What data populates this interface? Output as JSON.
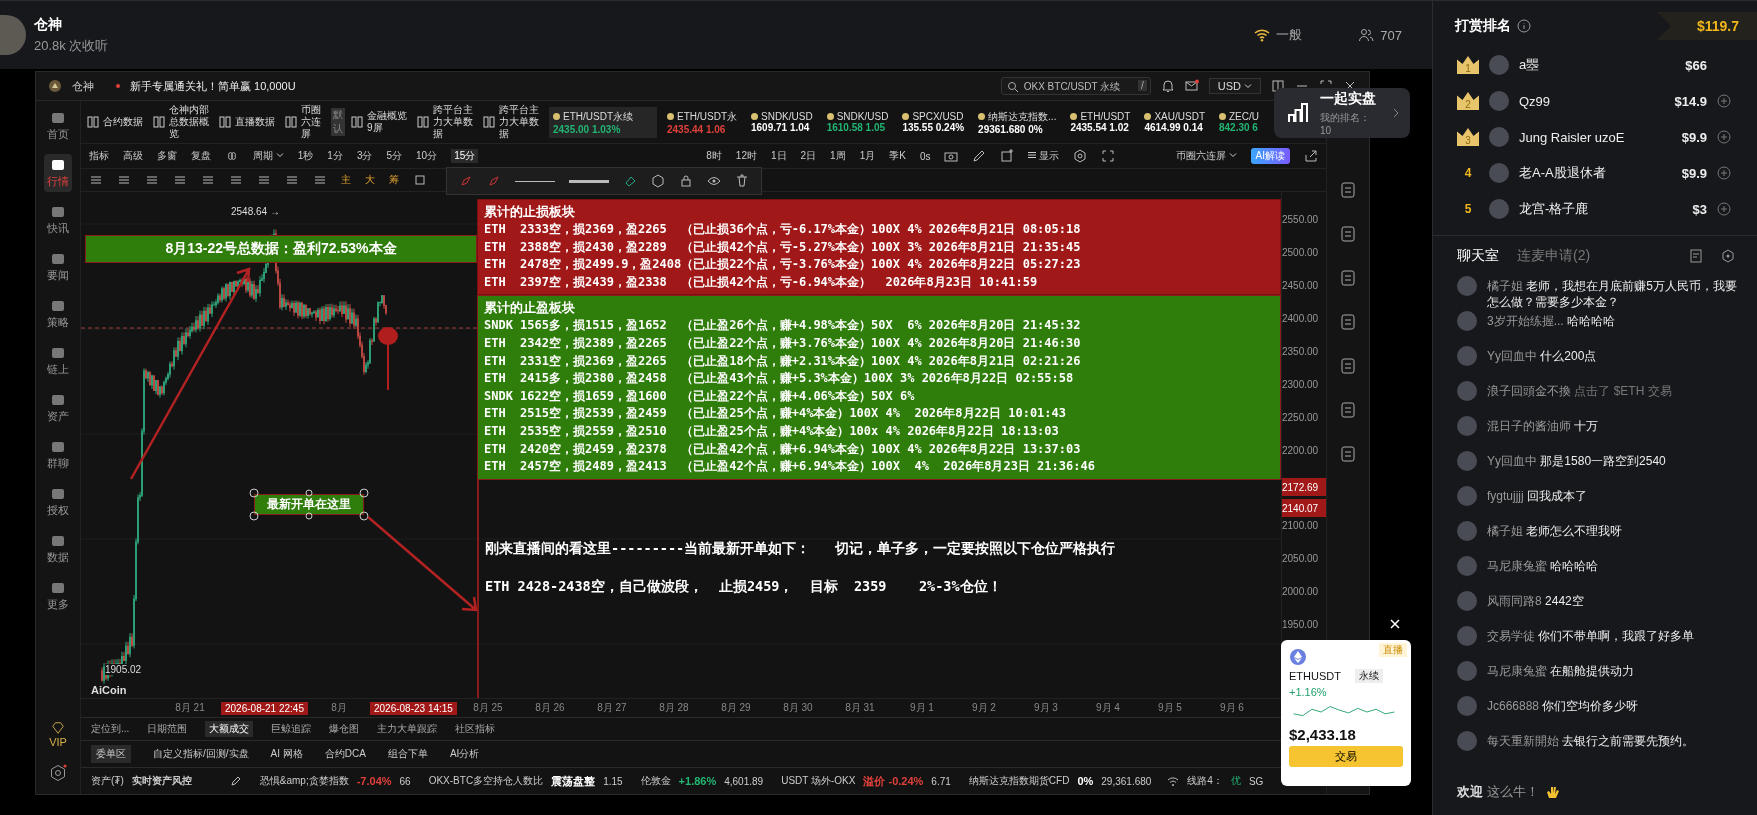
{
  "header": {
    "streamer": "仓神",
    "listeners": "20.8k 次收听",
    "signal": "一般",
    "viewers": "707"
  },
  "app": {
    "brand": "仓神",
    "promo": "新手专属通关礼！简单赢 10,000U",
    "search": {
      "placeholder": "OKX BTC/USDT 永续",
      "shortcut": "/"
    },
    "currency": "USD"
  },
  "sidebar": [
    {
      "label": "首页",
      "selected": false
    },
    {
      "label": "行情",
      "selected": true
    },
    {
      "label": "快讯",
      "selected": false
    },
    {
      "label": "要闻",
      "selected": false
    },
    {
      "label": "策略",
      "selected": false
    },
    {
      "label": "链上",
      "selected": false
    },
    {
      "label": "资产",
      "selected": false
    },
    {
      "label": "群聊",
      "selected": false
    },
    {
      "label": "授权",
      "selected": false
    },
    {
      "label": "数据",
      "selected": false
    },
    {
      "label": "更多",
      "selected": false
    }
  ],
  "vip": "VIP",
  "shortcuts": [
    {
      "label": "合约数据"
    },
    {
      "label": "仓神内部总数据概览"
    },
    {
      "label": "直播数据"
    },
    {
      "label": "币圈六连屏",
      "badge": "默认"
    },
    {
      "label": "金融概览9屏"
    },
    {
      "label": "跨平台主力大单数据"
    },
    {
      "label": "跨平台主力大单数据"
    }
  ],
  "tickers": [
    {
      "symbol": "ETH/USDT永续",
      "price": "2435.00",
      "change": "1.03%",
      "color": "#22b573",
      "selected": true
    },
    {
      "symbol": "ETH/USDT永",
      "price": "2435.44",
      "change": "1.06",
      "color": "#e0403a",
      "selected": false
    },
    {
      "symbol": "SNDK/USD",
      "price": "1609.71",
      "change": "1.04",
      "color": "#ffffff",
      "selected": false
    },
    {
      "symbol": "SNDK/USD",
      "price": "1610.58",
      "change": "1.05",
      "color": "#22b573",
      "selected": false
    },
    {
      "symbol": "SPCX/USD",
      "price": "135.55",
      "change": "0.24%",
      "color": "#ffffff",
      "selected": false
    },
    {
      "symbol": "纳斯达克指数...",
      "price": "29361.680",
      "change": "0%",
      "color": "#ffffff",
      "selected": false
    },
    {
      "symbol": "ETH/USDT",
      "price": "2435.54",
      "change": "1.02",
      "color": "#ffffff",
      "selected": false
    },
    {
      "symbol": "XAU/USDT",
      "price": "4614.99",
      "change": "0.14",
      "color": "#ffffff",
      "selected": false
    },
    {
      "symbol": "ZEC/U",
      "price": "842.30",
      "change": "6",
      "color": "#22b573",
      "selected": false
    }
  ],
  "toolbar": {
    "tools": [
      "指标",
      "高级",
      "多窗",
      "复盘"
    ],
    "period_menu": "周期",
    "periods": [
      {
        "label": "1秒",
        "selected": false
      },
      {
        "label": "1分",
        "selected": false
      },
      {
        "label": "3分",
        "selected": false
      },
      {
        "label": "5分",
        "selected": false
      },
      {
        "label": "10分",
        "selected": false
      },
      {
        "label": "15分",
        "selected": true
      },
      {
        "label": "8时",
        "selected": false
      },
      {
        "label": "12时",
        "selected": false
      },
      {
        "label": "1日",
        "selected": false
      },
      {
        "label": "2日",
        "selected": false
      },
      {
        "label": "1周",
        "selected": false
      },
      {
        "label": "1月",
        "selected": false
      },
      {
        "label": "季K",
        "selected": false
      }
    ],
    "countdown": "0s",
    "display": "显示",
    "layout": "币圈六连屏",
    "ai": "AI解读",
    "overlays": [
      "主",
      "大",
      "筹"
    ]
  },
  "chart": {
    "price_axis": [
      {
        "kind": "tick",
        "label": "2550.00"
      },
      {
        "kind": "tick",
        "label": "2500.00"
      },
      {
        "kind": "tick",
        "label": "2450.00"
      },
      {
        "kind": "tick",
        "label": "2400.00"
      },
      {
        "kind": "tick",
        "label": "2350.00"
      },
      {
        "kind": "tick",
        "label": "2300.00"
      },
      {
        "kind": "tick",
        "label": "2250.00"
      },
      {
        "kind": "tick",
        "label": "2200.00"
      },
      {
        "kind": "tag",
        "label": "2172.69"
      },
      {
        "kind": "tag",
        "label": "2140.07"
      },
      {
        "kind": "tick",
        "label": "2100.00"
      },
      {
        "kind": "tick",
        "label": "2050.00"
      },
      {
        "kind": "tick",
        "label": "2000.00"
      },
      {
        "kind": "tick",
        "label": "1950.00"
      }
    ],
    "time_axis": [
      {
        "kind": "tick",
        "label": "8月 21"
      },
      {
        "kind": "tag",
        "label": "2026-08-21 22:45"
      },
      {
        "kind": "tick",
        "label": "8月"
      },
      {
        "kind": "tag",
        "label": "2026-08-23 14:15"
      },
      {
        "kind": "tick",
        "label": "8月 25"
      },
      {
        "kind": "tick",
        "label": "8月 26"
      },
      {
        "kind": "tick",
        "label": "8月 27"
      },
      {
        "kind": "tick",
        "label": "8月 28"
      },
      {
        "kind": "tick",
        "label": "8月 29"
      },
      {
        "kind": "tick",
        "label": "8月 30"
      },
      {
        "kind": "tick",
        "label": "8月 31"
      },
      {
        "kind": "tick",
        "label": "9月 1"
      },
      {
        "kind": "tick",
        "label": "9月 2"
      },
      {
        "kind": "tick",
        "label": "9月 3"
      },
      {
        "kind": "tick",
        "label": "9月 4"
      },
      {
        "kind": "tick",
        "label": "9月 5"
      },
      {
        "kind": "tick",
        "label": "9月 6"
      }
    ],
    "high": "2548.64 →",
    "low": "1905.02",
    "logo": "AiCoin",
    "banner": "8月13-22号总数据：盈利72.53%本金",
    "marker": "最新开单在这里",
    "loss_block": {
      "title": "累计的止损板块",
      "lines": [
        "ETH  2333空，损2369，盈2265  （已止损36个点，亏-6.17%本金）100X 4% 2026年8月21日 08:05:18",
        "ETH  2388空，损2430，盈2289  （已止损42个点，亏-5.27%本金）100X 3% 2026年8月21日 21:35:45",
        "ETH  2478空，损2499.9，盈2408（已止损22个点，亏-3.76%本金）100X 4% 2026年8月22日 05:27:23",
        "ETH  2397空，损2439，盈2338  （已止损42个点，亏-6.94%本金）  2026年8月23日 10:41:59"
      ]
    },
    "profit_block": {
      "title": "累计的止盈板块",
      "lines": [
        "SNDK 1565多，损1515，盈1652  （已止盈26个点，赚+4.98%本金）50X  6% 2026年8月20日 21:45:32",
        "ETH  2342空，损2389，盈2265  （已止盈22个点，赚+3.76%本金）100X 4% 2026年8月20日 21:46:30",
        "ETH  2331空，损2369，盈2265  （已止盈18个点，赚+2.31%本金）100X 4% 2026年8月21日 02:21:26",
        "ETH  2415多，损2380，盈2458  （已止盈43个点，赚+5.3%本金）100X 3% 2026年8月22日 02:55:58",
        "SNDK 1622空，损1659，盈1600  （已止盈22个点，赚+4.06%本金）50X 6%",
        "ETH  2515空，损2539，盈2459  （已止盈25个点，赚+4%本金）100X 4%  2026年8月22日 10:01:43",
        "ETH  2535空，损2559，盈2510  （已止盈25个点，赚+4%本金）100x 4% 2026年8月22日 18:13:03",
        "ETH  2420空，损2459，盈2378  （已止盈42个点，赚+6.94%本金）100X 4% 2026年8月22日 13:37:03",
        "ETH  2457空，损2489，盈2413  （已止盈42个点，赚+6.94%本金）100X  4%  2026年8月23日 21:36:46"
      ]
    },
    "notes": [
      "刚来直播间的看这里---------当前最新开单如下：   切记，单子多，一定要按照以下仓位严格执行",
      "ETH 2428-2438空，自己做波段，  止损2459，  目标  2359    2%-3%仓位！"
    ]
  },
  "bottom_tabs": [
    {
      "label": "定位到...",
      "selected": false
    },
    {
      "label": "日期范围",
      "selected": false
    },
    {
      "label": "大额成交",
      "selected": true
    },
    {
      "label": "巨鲸追踪",
      "selected": false
    },
    {
      "label": "爆仓图",
      "selected": false
    },
    {
      "label": "主力大单跟踪",
      "selected": false
    },
    {
      "label": "社区指标",
      "selected": false
    }
  ],
  "order_tabs": [
    {
      "label": "委单区",
      "selected": true
    },
    {
      "label": "自定义指标/回测/实盘",
      "selected": false
    },
    {
      "label": "AI 网格",
      "selected": false
    },
    {
      "label": "合约DCA",
      "selected": false
    },
    {
      "label": "组合下单",
      "selected": false
    },
    {
      "label": "AI分析",
      "selected": false
    }
  ],
  "status_bar": {
    "assets": "资产(₮)",
    "risk": "实时资产风控",
    "items": [
      {
        "name": "恐惧&amp;贪婪指数",
        "change": "-7.04%",
        "color": "#e0403a",
        "value": "66"
      },
      {
        "name": "OKX-BTC多空持仓人数比",
        "change": "震荡盘整",
        "color": "#ffffff",
        "value": "1.15"
      },
      {
        "name": "伦敦金",
        "change": "+1.86%",
        "color": "#22b573",
        "value": "4,601.89"
      },
      {
        "name": "USDT 场外-OKX",
        "change": "溢价 -0.24%",
        "color": "#e0403a",
        "value": "6.71"
      },
      {
        "name": "纳斯达克指数期货CFD",
        "change": "0%",
        "color": "#ffffff",
        "value": "29,361.680"
      }
    ],
    "line": "线路4：",
    "quality": "优",
    "cut": "SG"
  },
  "live_popup": {
    "title": "一起实盘",
    "rank": "我的排名： 10"
  },
  "mini_card": {
    "live": "直播",
    "symbol": "ETHUSDT",
    "type": "永续",
    "change": "+1.16%",
    "price": "$2,433.18",
    "action": "交易"
  },
  "ranking": {
    "title": "打赏排名",
    "total": "$119.7",
    "entries": [
      {
        "rank": "1",
        "kind": "crown",
        "name": "a瞾",
        "amount": "$66",
        "follow": false
      },
      {
        "rank": "2",
        "kind": "crown",
        "name": "Qz99",
        "amount": "$14.9",
        "follow": true
      },
      {
        "rank": "3",
        "kind": "crown",
        "name": "Jung Raisler uzoE",
        "amount": "$9.9",
        "follow": true
      },
      {
        "rank": "4",
        "kind": "plain",
        "name": "老A-A股退休者",
        "amount": "$9.9",
        "follow": true
      },
      {
        "rank": "5",
        "kind": "plain",
        "name": "龙宫-格子鹿",
        "amount": "$3",
        "follow": true
      }
    ]
  },
  "chat": {
    "tabs": [
      {
        "label": "聊天室",
        "selected": true
      },
      {
        "label": "连麦申请(2)",
        "selected": false
      }
    ],
    "messages": [
      {
        "name": "橘子姐",
        "kind": "message",
        "text": "老师，我想在月底前赚5万人民币，我要怎么做？需要多少本金？"
      },
      {
        "name": "3岁开始练握...",
        "kind": "message",
        "text": "哈哈哈哈"
      },
      {
        "name": "Yy回血中",
        "kind": "message",
        "text": "什么200点"
      },
      {
        "name": "浪子回頭金不換",
        "kind": "action",
        "text": "点击了 $ETH 交易"
      },
      {
        "name": "混日子的酱油师",
        "kind": "message",
        "text": "十万"
      },
      {
        "name": "Yy回血中",
        "kind": "message",
        "text": "那是1580一路空到2540"
      },
      {
        "name": "fygtujjjj",
        "kind": "message",
        "text": "回我成本了"
      },
      {
        "name": "橘子姐",
        "kind": "message",
        "text": "老师怎么不理我呀"
      },
      {
        "name": "马尼康兔蜜",
        "kind": "message",
        "text": "哈哈哈哈"
      },
      {
        "name": "风雨同路8",
        "kind": "message",
        "text": "2442空"
      },
      {
        "name": "交易学徒",
        "kind": "message",
        "text": "你们不带单啊，我跟了好多单"
      },
      {
        "name": "马尼康兔蜜",
        "kind": "message",
        "text": "在船舱提供动力"
      },
      {
        "name": "Jc666888",
        "kind": "message",
        "text": "你们空均价多少呀"
      },
      {
        "name": "每天重新開始",
        "kind": "message",
        "text": "去银行之前需要先预约。"
      }
    ],
    "welcome": {
      "label": "欢迎",
      "text": "这么牛！"
    }
  }
}
